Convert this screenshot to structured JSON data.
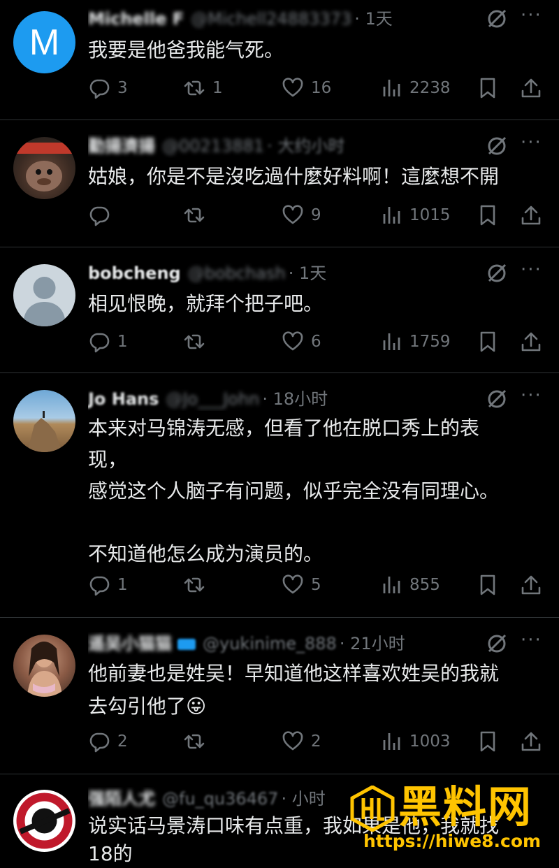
{
  "colors": {
    "background": "#000000",
    "text": "#e7e9ea",
    "muted": "#71767b",
    "divider": "#2f3336",
    "watermark": "#ffc400"
  },
  "tweets": [
    {
      "name": "Michelle F",
      "handle": "@Michell24883373",
      "time": "· 1天",
      "avatar": "letter-m-avatar",
      "avatar_letter": "M",
      "text": "我要是他爸我能气死。",
      "replies": "3",
      "retweets": "1",
      "likes": "16",
      "views": "2238"
    },
    {
      "name": "勤揚濟揚",
      "handle": "@00213881",
      "time": "· 大约小时",
      "avatar": "cartoon-avatar",
      "text": "姑娘，你是不是沒吃過什麼好料啊！這麼想不開",
      "replies": "",
      "retweets": "",
      "likes": "9",
      "views": "1015"
    },
    {
      "name": "bobcheng",
      "handle": "@bobchash",
      "time": "· 1天",
      "avatar": "default-avatar",
      "text": "相见恨晚，就拜个把子吧。",
      "replies": "1",
      "retweets": "",
      "likes": "6",
      "views": "1759"
    },
    {
      "name": "Jo Hans",
      "handle": "@Jo___John",
      "time": "· 18小时",
      "avatar": "landscape-avatar",
      "text": "本来对马锦涛无感，但看了他在脱口秀上的表\n现，\n感觉这个人脑子有问题，似乎完全没有同理心。\n\n不知道他怎么成为演员的。",
      "replies": "1",
      "retweets": "",
      "likes": "5",
      "views": "855"
    },
    {
      "name": "遥吴小猫猫",
      "handle": "@yukinime_888",
      "time": "· 21小时",
      "avatar": "woman-avatar",
      "text": "他前妻也是姓吴！早知道他这样喜欢姓吴的我就\n去勾引他了😛",
      "replies": "2",
      "retweets": "",
      "likes": "2",
      "views": "1003"
    },
    {
      "name": "强陌人尤",
      "handle": "@fu_qu36467",
      "time": "· 小时",
      "avatar": "logo-avatar",
      "text": "说实话马景涛口味有点重，我如果是他，我就找\n18的",
      "replies": "",
      "retweets": "",
      "likes": "",
      "views": ""
    }
  ],
  "watermark": {
    "title": "黑料网",
    "url": "https://hiwe8.com"
  }
}
